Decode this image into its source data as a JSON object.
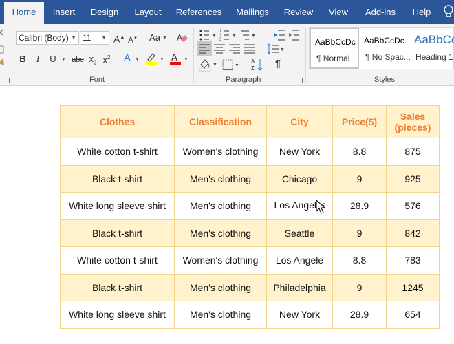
{
  "ribbon": {
    "tabs": [
      {
        "label": "Home",
        "active": true
      },
      {
        "label": "Insert"
      },
      {
        "label": "Design"
      },
      {
        "label": "Layout"
      },
      {
        "label": "References"
      },
      {
        "label": "Mailings"
      },
      {
        "label": "Review"
      },
      {
        "label": "View"
      },
      {
        "label": "Add-ins"
      },
      {
        "label": "Help"
      }
    ],
    "font": {
      "name": "Calibri (Body)",
      "size": "11",
      "group_label": "Font"
    },
    "paragraph": {
      "group_label": "Paragraph"
    },
    "styles": {
      "group_label": "Styles",
      "items": [
        {
          "sample": "AaBbCcDc",
          "name": "¶ Normal"
        },
        {
          "sample": "AaBbCcDc",
          "name": "¶ No Spac..."
        },
        {
          "sample": "AaBbCc",
          "name": "Heading 1"
        }
      ]
    },
    "colors": {
      "tab_bar": "#2b579a",
      "highlight": "#ffff00",
      "font_color": "#ff0000"
    }
  },
  "table": {
    "header_color": "#ed7d31",
    "fill_color": "#fff2cc",
    "headers": [
      "Clothes",
      "Classification",
      "City",
      "Price($)",
      "Sales (pieces)"
    ],
    "rows": [
      [
        "White cotton t-shirt",
        "Women's clothing",
        "New York",
        "8.8",
        "875"
      ],
      [
        "Black t-shirt",
        "Men's clothing",
        "Chicago",
        "9",
        "925"
      ],
      [
        "White long sleeve shirt",
        "Men's clothing",
        "Los Angeles",
        "28.9",
        "576"
      ],
      [
        "Black t-shirt",
        "Men's clothing",
        "Seattle",
        "9",
        "842"
      ],
      [
        "White cotton t-shirt",
        "Women's clothing",
        "Los Angele",
        "8.8",
        "783"
      ],
      [
        "Black t-shirt",
        "Men's clothing",
        "Philadelphia",
        "9",
        "1245"
      ],
      [
        "White long sleeve shirt",
        "Men's clothing",
        "New York",
        "28.9",
        "654"
      ]
    ]
  }
}
